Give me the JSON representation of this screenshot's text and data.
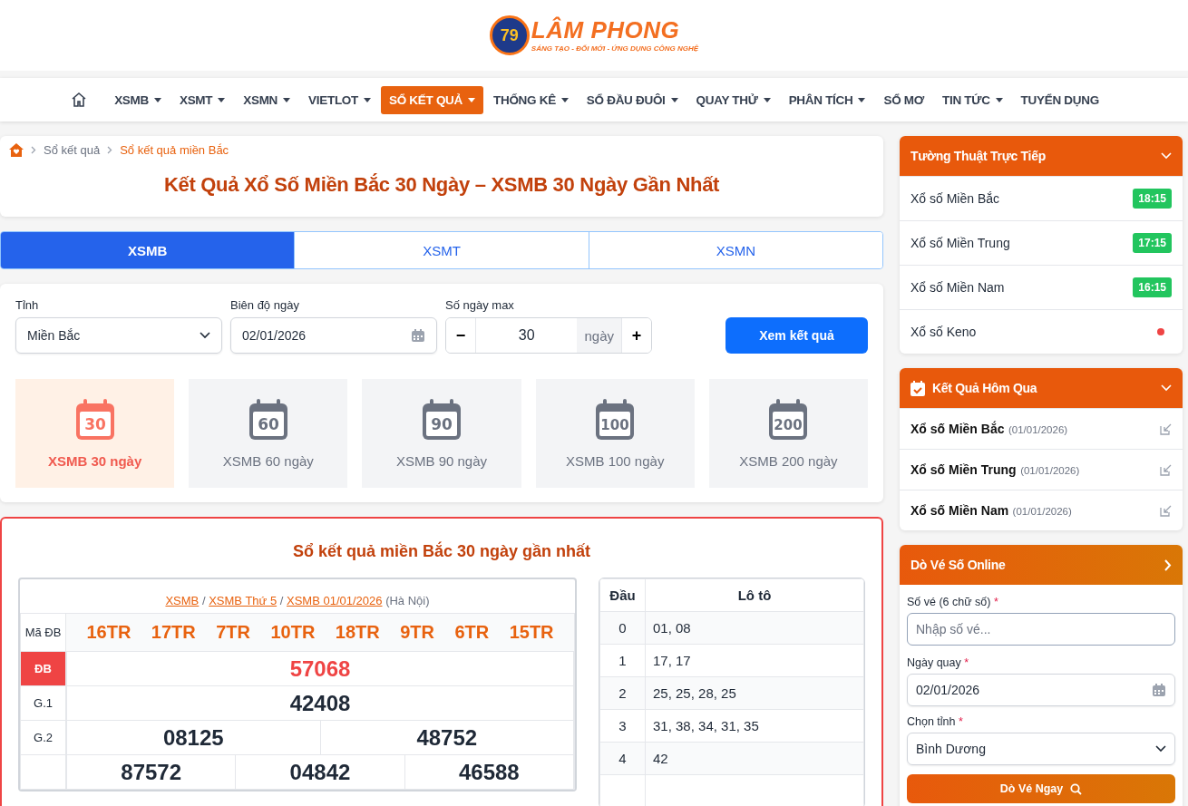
{
  "logo": {
    "badge": "79",
    "name": "LÂM PHONG",
    "tagline": "SÁNG TẠO - ĐỔI MỚI - ỨNG DỤNG CÔNG NGHỆ"
  },
  "nav": [
    {
      "label": "XSMB",
      "dropdown": true,
      "selected": false
    },
    {
      "label": "XSMT",
      "dropdown": true,
      "selected": false
    },
    {
      "label": "XSMN",
      "dropdown": true,
      "selected": false
    },
    {
      "label": "VIETLOT",
      "dropdown": true,
      "selected": false
    },
    {
      "label": "SỔ KẾT QUẢ",
      "dropdown": true,
      "selected": true
    },
    {
      "label": "THỐNG KÊ",
      "dropdown": true,
      "selected": false
    },
    {
      "label": "SỔ ĐẦU ĐUÔI",
      "dropdown": true,
      "selected": false
    },
    {
      "label": "QUAY THỬ",
      "dropdown": true,
      "selected": false
    },
    {
      "label": "PHÂN TÍCH",
      "dropdown": true,
      "selected": false
    },
    {
      "label": "SỔ MƠ",
      "dropdown": false,
      "selected": false
    },
    {
      "label": "TIN TỨC",
      "dropdown": true,
      "selected": false
    },
    {
      "label": "TUYỂN DỤNG",
      "dropdown": false,
      "selected": false
    }
  ],
  "breadcrumb": [
    "Sổ kết quả",
    "Sổ kết quả miền Bắc"
  ],
  "page_title": "Kết Quả Xổ Số Miền Bắc 30 Ngày – XSMB 30 Ngày Gần Nhất",
  "region_tabs": [
    {
      "label": "XSMB",
      "selected": true
    },
    {
      "label": "XSMT",
      "selected": false
    },
    {
      "label": "XSMN",
      "selected": false
    }
  ],
  "filter": {
    "province_label": "Tỉnh",
    "province": "Miền Bắc",
    "date_label": "Biên độ ngày",
    "date": "02/01/2026",
    "days_label": "Số ngày max",
    "minus": "−",
    "days": "30",
    "unit": "ngày",
    "plus": "+",
    "submit": "Xem kết quả"
  },
  "presets": [
    {
      "number": "30",
      "label": "XSMB 30 ngày",
      "selected": true
    },
    {
      "number": "60",
      "label": "XSMB 60 ngày",
      "selected": false
    },
    {
      "number": "90",
      "label": "XSMB 90 ngày",
      "selected": false
    },
    {
      "number": "100",
      "label": "XSMB 100 ngày",
      "selected": false
    },
    {
      "number": "200",
      "label": "XSMB 200 ngày",
      "selected": false
    }
  ],
  "results": {
    "title": "Sổ kết quả miền Bắc 30 ngày gần nhất",
    "links": [
      "XSMB",
      "XSMB Thứ 5",
      "XSMB 01/01/2026"
    ],
    "link_separator": "/",
    "location": "(Hà Nội)",
    "code_label": "Mã ĐB",
    "codes": [
      "16TR",
      "17TR",
      "7TR",
      "10TR",
      "18TR",
      "9TR",
      "6TR",
      "15TR"
    ],
    "prizes": [
      {
        "kind": "special",
        "label": "ĐB",
        "numbers": [
          "57068"
        ]
      },
      {
        "kind": "normal",
        "label": "G.1",
        "numbers": [
          "42408"
        ]
      },
      {
        "kind": "normal",
        "label": "G.2",
        "numbers": [
          "08125",
          "48752"
        ]
      },
      {
        "kind": "normal",
        "numbers": [
          "87572",
          "04842",
          "46588"
        ]
      }
    ],
    "loto_head": "Đầu",
    "loto_title": "Lô tô",
    "loto": [
      {
        "head": "0",
        "values": "01, 08"
      },
      {
        "head": "1",
        "values": "17, 17"
      },
      {
        "head": "2",
        "values": "25, 25, 28, 25"
      },
      {
        "head": "3",
        "values": "31, 38, 34, 31, 35"
      },
      {
        "head": "4",
        "values": "42"
      }
    ]
  },
  "live": {
    "title": "Tường Thuật Trực Tiếp",
    "items": [
      {
        "name": "Xổ số Miền Bắc",
        "kind": "time",
        "time": "18:15"
      },
      {
        "name": "Xổ số Miền Trung",
        "kind": "time",
        "time": "17:15"
      },
      {
        "name": "Xổ số Miền Nam",
        "kind": "time",
        "time": "16:15"
      },
      {
        "name": "Xổ số Keno",
        "kind": "dot",
        "color": "#ef4444"
      }
    ]
  },
  "yesterday": {
    "title": "Kết Quả Hôm Qua",
    "items": [
      {
        "name": "Xổ số Miền Bắc",
        "date": "(01/01/2026)"
      },
      {
        "name": "Xổ số Miền Trung",
        "date": "(01/01/2026)"
      },
      {
        "name": "Xổ số Miền Nam",
        "date": "(01/01/2026)"
      }
    ]
  },
  "ticket": {
    "title": "Dò Vé Số Online",
    "number_label": "Số vé (6 chữ số)",
    "number_placeholder": "Nhập số vé...",
    "date_label": "Ngày quay",
    "date": "02/01/2026",
    "province_label": "Chọn tỉnh",
    "province": "Bình Dương",
    "required": "*",
    "submit": "Dò Vé Ngay"
  }
}
